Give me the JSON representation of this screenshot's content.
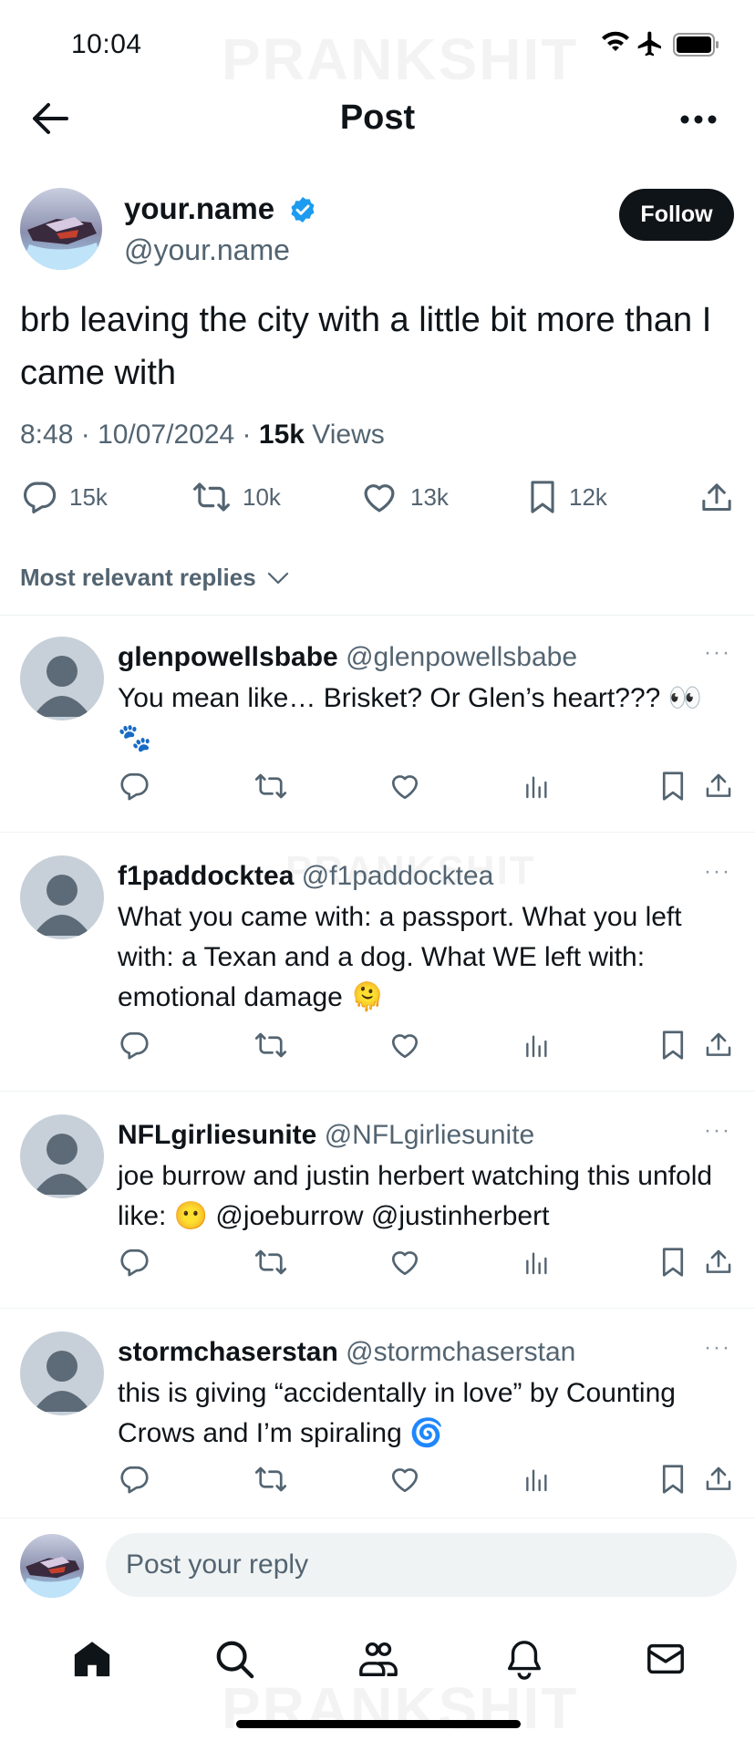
{
  "status_bar": {
    "time": "10:04",
    "watermark": "PRANKSHIT"
  },
  "header": {
    "title": "Post",
    "back_icon": "arrow-left-icon",
    "more_icon": "more-horizontal-icon"
  },
  "post": {
    "author_name": "your.name",
    "author_handle": "@your.name",
    "follow_label": "Follow",
    "text": "brb leaving the city with a little bit more than I came with",
    "time": "8:48",
    "date": "10/07/2024",
    "views_count": "15k",
    "views_label": "Views",
    "stats": {
      "replies": "15k",
      "reposts": "10k",
      "likes": "13k",
      "bookmarks": "12k"
    }
  },
  "replies_filter": "Most relevant replies",
  "replies": [
    {
      "name": "glenpowellsbabe",
      "handle": "@glenpowellsbabe",
      "text": "You mean like… Brisket? Or Glen’s heart??? 👀 🐾"
    },
    {
      "name": "f1paddocktea",
      "handle": "@f1paddocktea",
      "text": "What you came with: a passport. What you left with: a Texan and a dog. What WE left with: emotional damage 🫠"
    },
    {
      "name": "NFLgirliesunite",
      "handle": "@NFLgirliesunite",
      "text": "joe burrow and justin herbert watching this unfold like: 😶  @joeburrow @justinherbert"
    },
    {
      "name": "stormchaserstan",
      "handle": "@stormchaserstan",
      "text": "this is giving “accidentally in love” by Counting Crows and I’m spiraling 🌀"
    }
  ],
  "composer": {
    "placeholder": "Post your reply"
  },
  "colors": {
    "text": "#0f1419",
    "secondary": "#536471",
    "verified": "#1d9bf0",
    "divider": "#eff3f4"
  }
}
